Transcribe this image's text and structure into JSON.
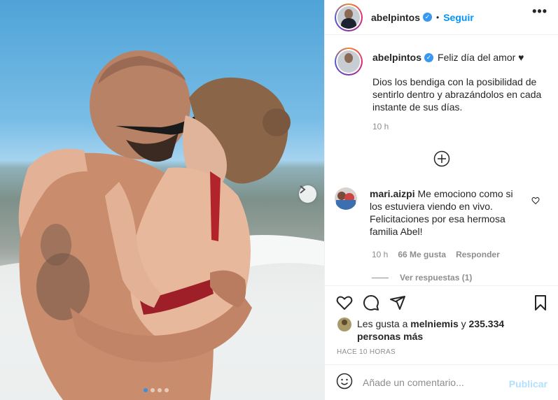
{
  "post": {
    "username": "abelpintos",
    "verified_icon": "verified-badge-icon",
    "follow_label": "Seguir",
    "more_label": "•••",
    "separator": "•"
  },
  "caption": {
    "username": "abelpintos",
    "title": "Feliz día del amor ♥",
    "body": "Dios los bendiga con la posibilidad de sentirlo dentro y abrazándolos en cada instante de sus días.",
    "time": "10 h"
  },
  "comment": {
    "username": "mari.aizpi",
    "text": "Me emociono como si los estuviera viendo en vivo. Felicitaciones por esa hermosa familia Abel!",
    "time": "10 h",
    "likes": "66 Me gusta",
    "reply_label": "Responder",
    "view_replies": "Ver respuestas (1)"
  },
  "likes": {
    "prefix": "Les gusta a",
    "user": "melniemis",
    "conjunction": "y",
    "count": "235.334 personas más"
  },
  "timestamp": "HACE 10 HORAS",
  "composer": {
    "placeholder": "Añade un comentario...",
    "publish_label": "Publicar"
  },
  "carousel": {
    "total": 4,
    "active": 1
  },
  "colors": {
    "accent": "#0095f6",
    "verified": "#3897f0",
    "publish_disabled": "#b2dffc"
  }
}
